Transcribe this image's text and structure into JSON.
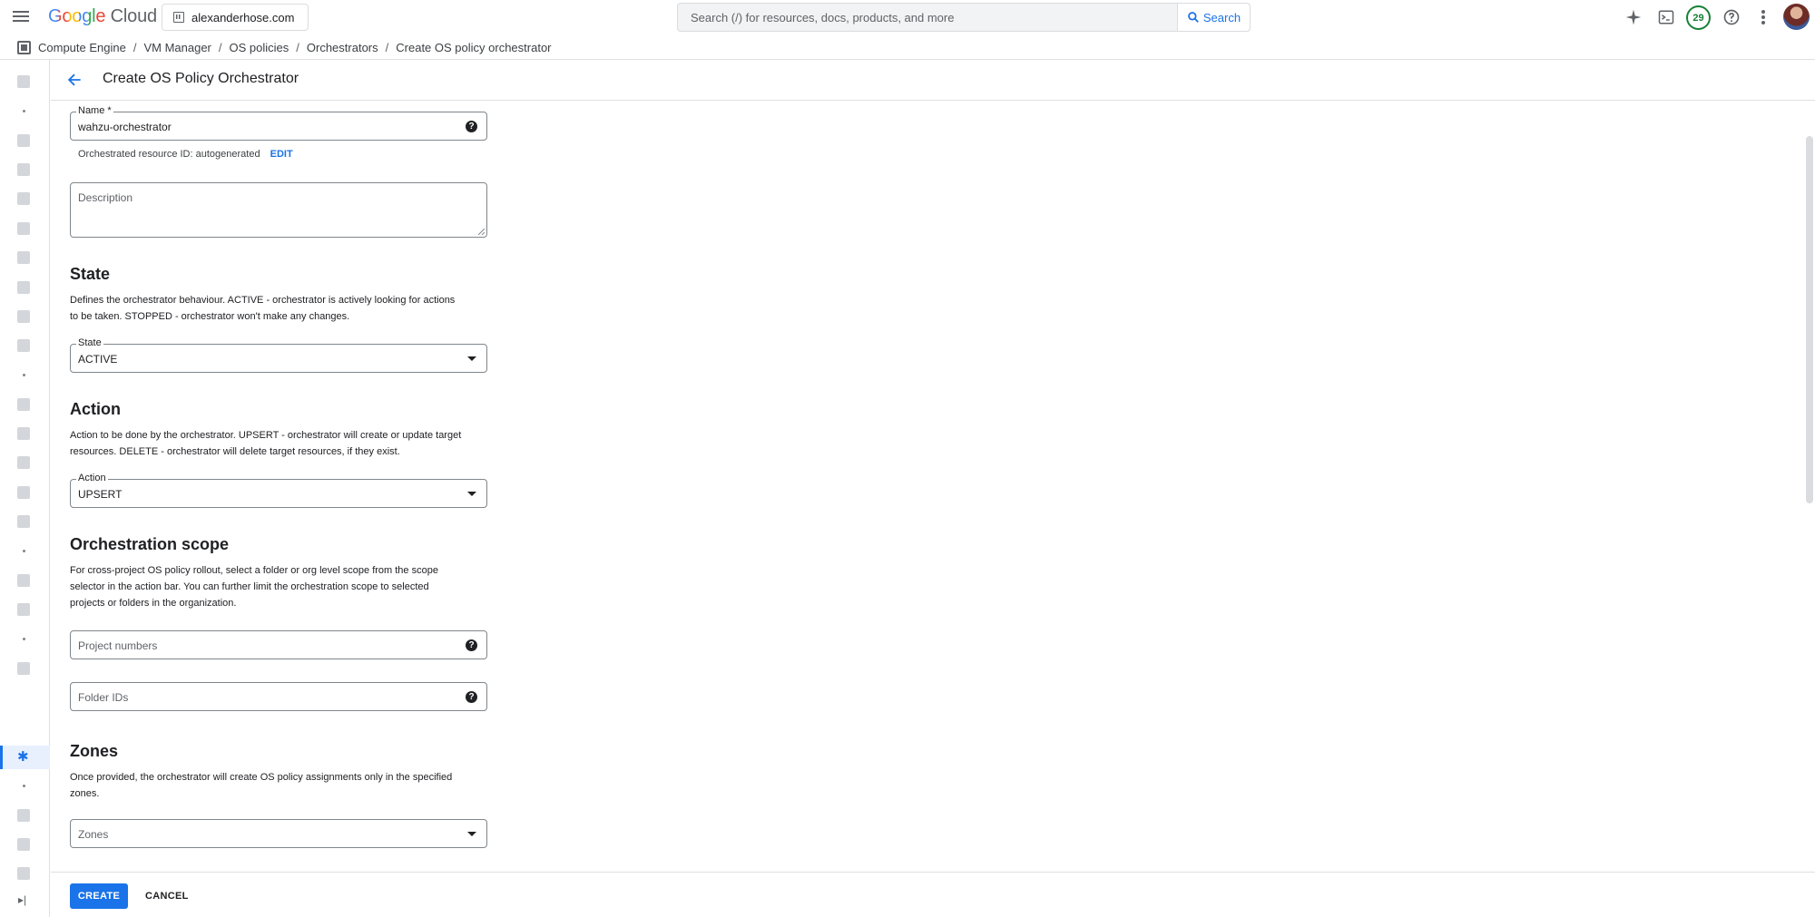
{
  "topbar": {
    "logo_google": "Google",
    "logo_cloud": "Cloud",
    "project": "alexanderhose.com",
    "search_placeholder": "Search (/) for resources, docs, products, and more",
    "search_button": "Search",
    "notification_count": "29",
    "icons": [
      "menu-icon",
      "sparkle-icon",
      "terminal-icon",
      "help-icon",
      "more-vert-icon"
    ]
  },
  "breadcrumb": {
    "items": [
      "Compute Engine",
      "VM Manager",
      "OS policies",
      "Orchestrators",
      "Create OS policy orchestrator"
    ],
    "separator": "/"
  },
  "page": {
    "title": "Create OS Policy Orchestrator"
  },
  "form": {
    "name": {
      "label": "Name *",
      "value": "wahzu-orchestrator"
    },
    "resource_id": {
      "text": "Orchestrated resource ID: autogenerated",
      "edit": "EDIT"
    },
    "description": {
      "placeholder": "Description"
    },
    "state_section": {
      "heading": "State",
      "desc_line1": "Defines the orchestrator behaviour. ACTIVE - orchestrator is actively looking for actions",
      "desc_line2": "to be taken. STOPPED - orchestrator won't make any changes.",
      "field_label": "State",
      "value": "ACTIVE"
    },
    "action_section": {
      "heading": "Action",
      "desc_line1": "Action to be done by the orchestrator. UPSERT - orchestrator will create or update target",
      "desc_line2": "resources. DELETE - orchestrator will delete target resources, if they exist.",
      "field_label": "Action",
      "value": "UPSERT"
    },
    "scope_section": {
      "heading": "Orchestration scope",
      "desc_line1": "For cross-project OS policy rollout, select a folder or org level scope from the scope",
      "desc_line2": "selector in the action bar. You can further limit the orchestration scope to selected",
      "desc_line3": "projects or folders in the organization.",
      "project_numbers_placeholder": "Project numbers",
      "folder_ids_placeholder": "Folder IDs"
    },
    "zones_section": {
      "heading": "Zones",
      "desc_line1": "Once provided, the orchestrator will create OS policy assignments only in the specified",
      "desc_line2": "zones.",
      "placeholder": "Zones"
    }
  },
  "footer": {
    "create": "CREATE",
    "cancel": "CANCEL"
  },
  "colors": {
    "accent": "#1a73e8",
    "badge": "#188038"
  }
}
